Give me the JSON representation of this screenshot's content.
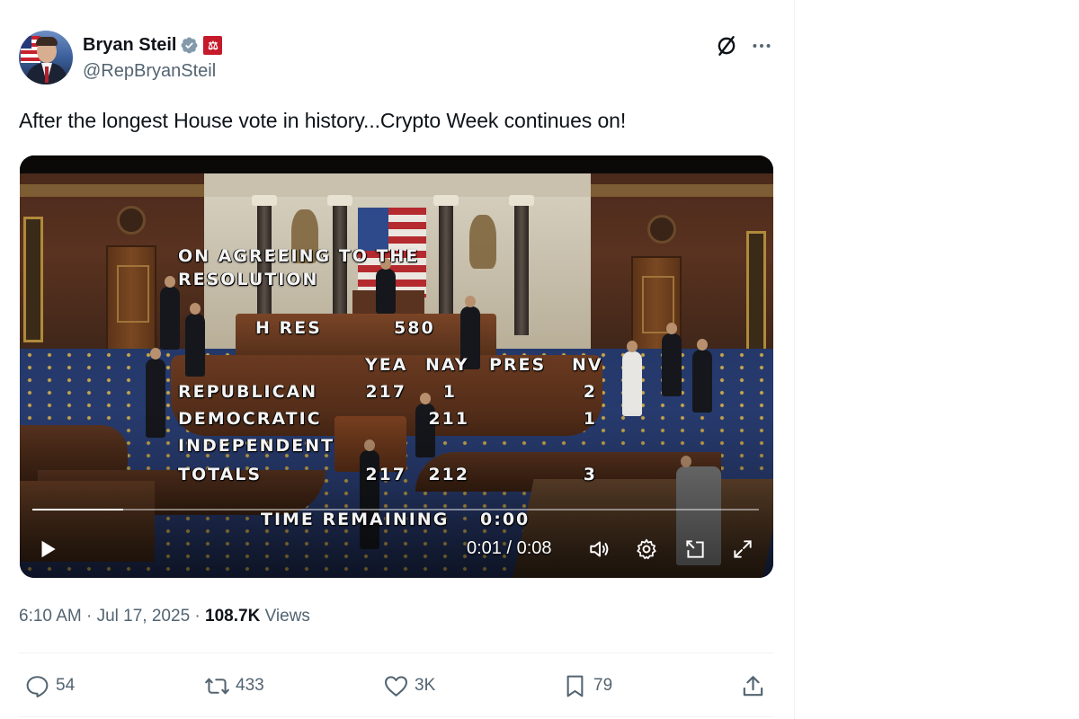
{
  "author": {
    "name": "Bryan Steil",
    "handle": "@RepBryanSteil",
    "verified": true,
    "affiliation_badge_glyph": "⚖"
  },
  "tweet": {
    "text": "After the longest House vote in history...Crypto Week continues on!"
  },
  "video": {
    "overlay": {
      "title_line1": "ON AGREEING TO THE",
      "title_line2": "RESOLUTION",
      "measure_label": "H RES",
      "measure_number": "580",
      "columns": [
        "YEA",
        "NAY",
        "PRES",
        "NV"
      ],
      "rows": [
        {
          "party": "REPUBLICAN",
          "yea": "217",
          "nay": "1",
          "pres": "",
          "nv": "2"
        },
        {
          "party": "DEMOCRATIC",
          "yea": "",
          "nay": "211",
          "pres": "",
          "nv": "1"
        },
        {
          "party": "INDEPENDENT",
          "yea": "",
          "nay": "",
          "pres": "",
          "nv": ""
        },
        {
          "party": "TOTALS",
          "yea": "217",
          "nay": "212",
          "pres": "",
          "nv": "3"
        }
      ],
      "time_remaining_label": "TIME REMAINING",
      "time_remaining_value": "0:00"
    },
    "player": {
      "time": "0:01 / 0:08",
      "progress_fraction": 0.125,
      "icons": [
        "play-icon",
        "volume-icon",
        "settings-icon",
        "pip-icon",
        "fullscreen-icon"
      ]
    }
  },
  "meta": {
    "time": "6:10 AM",
    "date": "Jul 17, 2025",
    "views_count": "108.7K",
    "views_label": "Views",
    "separator": "·"
  },
  "actions": {
    "replies": "54",
    "reposts": "433",
    "likes": "3K",
    "bookmarks": "79"
  },
  "colors": {
    "text_primary": "#0f1419",
    "text_secondary": "#536471",
    "verified_blue": "#829aab",
    "badge_red": "#c51a2a",
    "divider": "#eff3f4"
  }
}
